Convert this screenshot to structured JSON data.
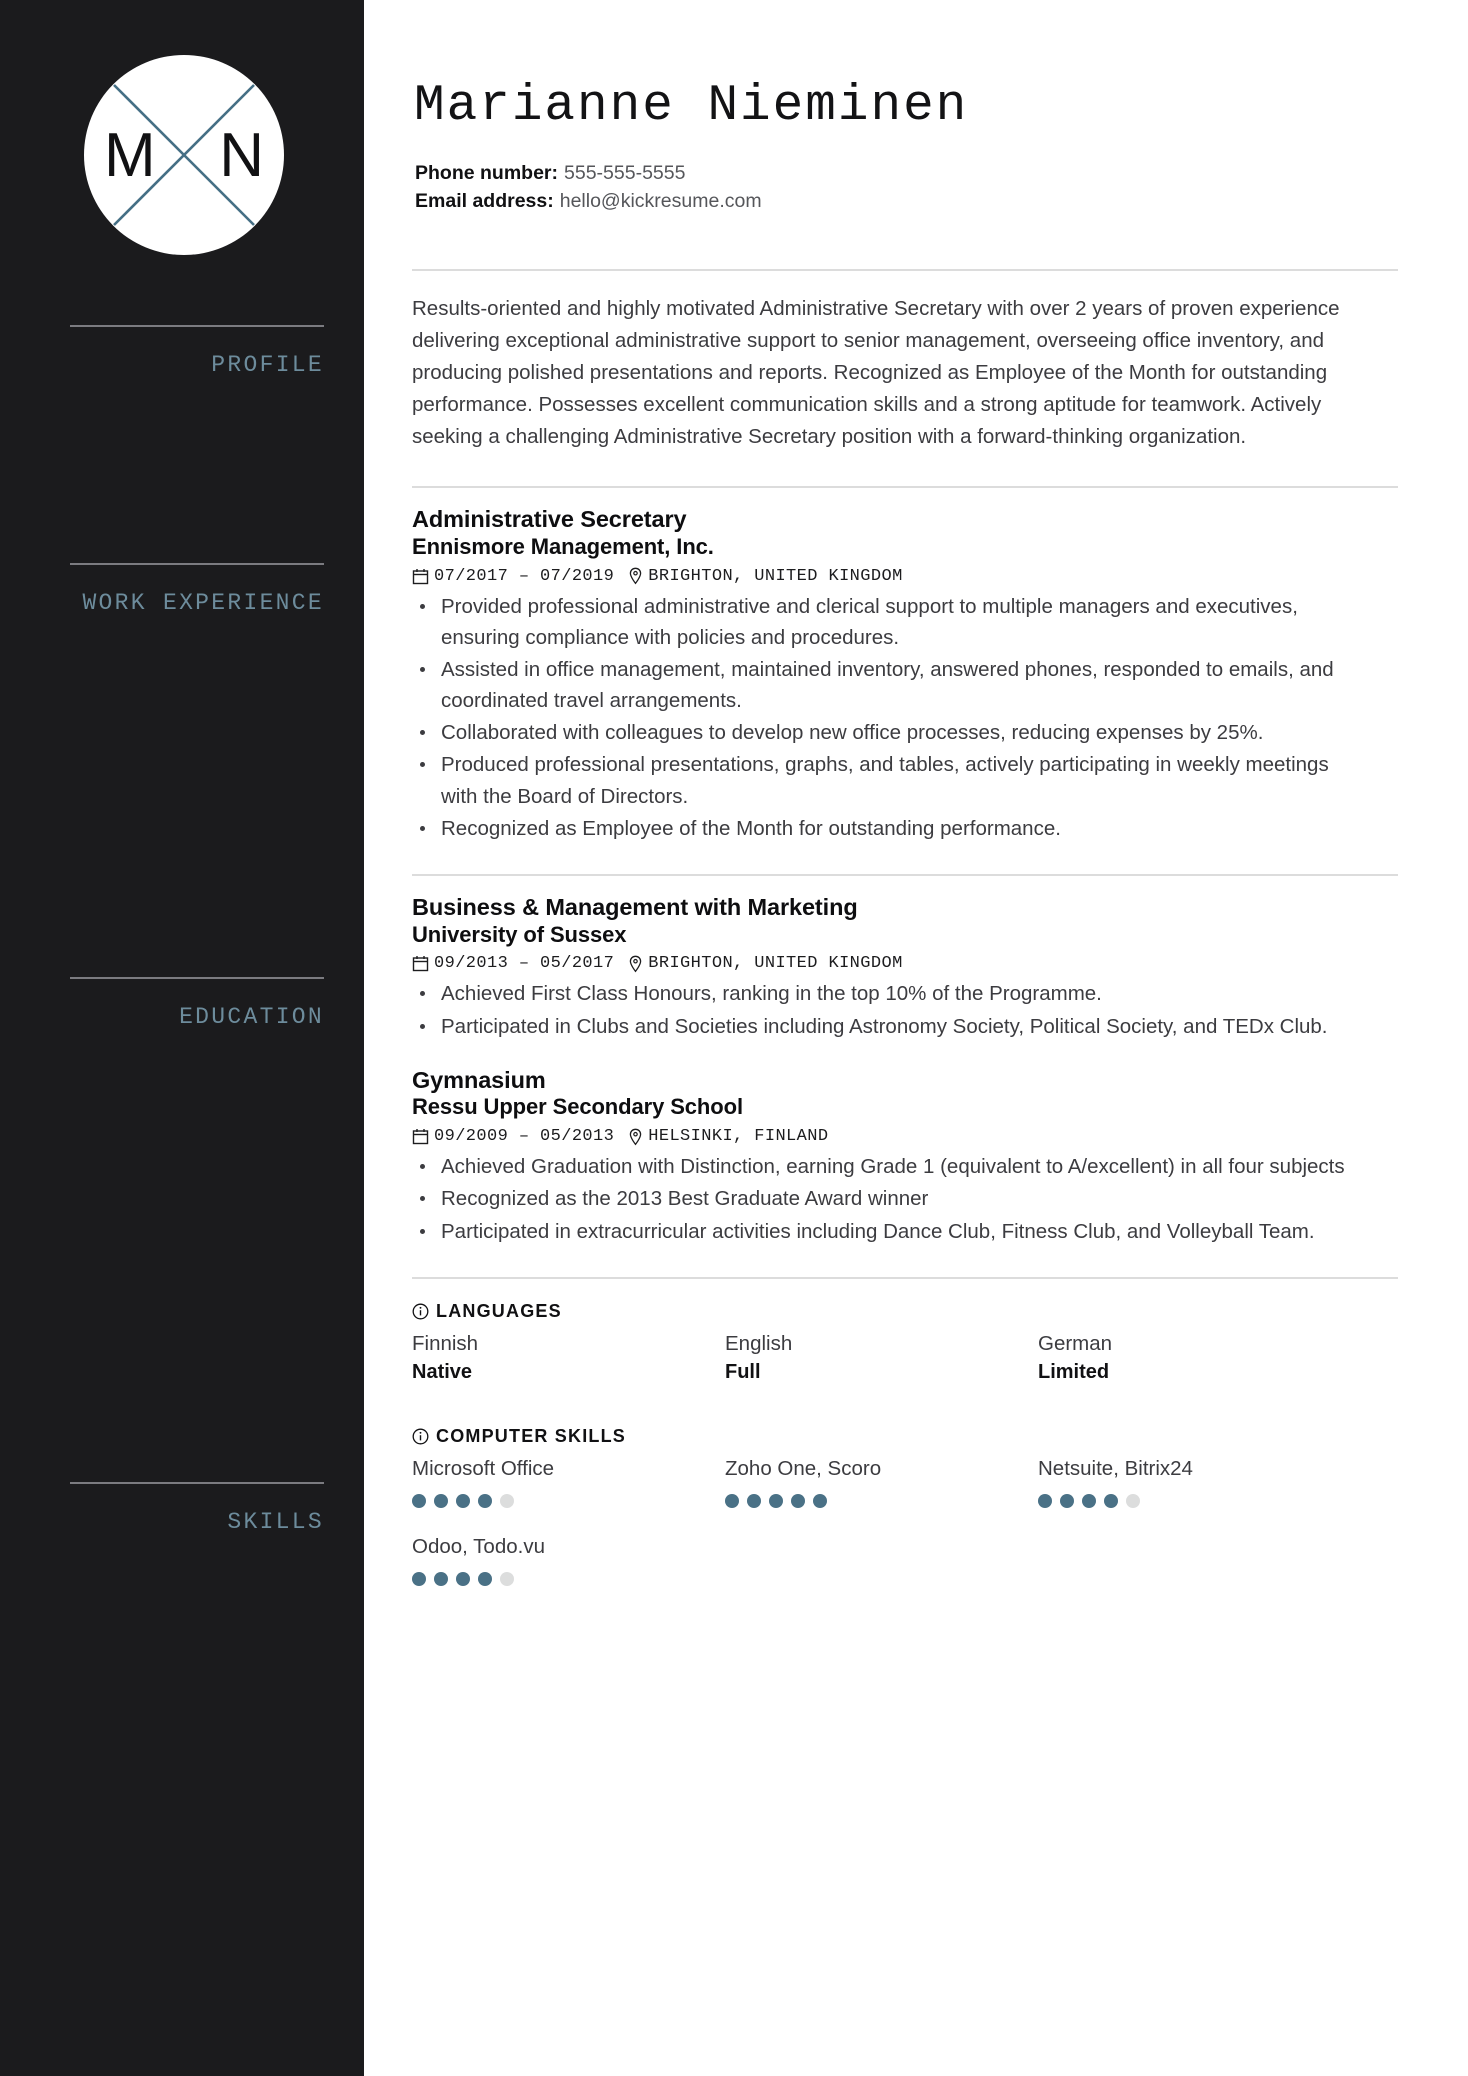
{
  "sidebar": {
    "monogram": {
      "left_letter": "M",
      "right_letter": "N",
      "icon": "monogram-cross-icon"
    },
    "sections": [
      {
        "key": "profile",
        "label": "PROFILE"
      },
      {
        "key": "work",
        "label": "WORK EXPERIENCE"
      },
      {
        "key": "education",
        "label": "EDUCATION"
      },
      {
        "key": "skills",
        "label": "SKILLS"
      }
    ]
  },
  "header": {
    "name": "Marianne Nieminen",
    "phone_label": "Phone number:",
    "phone_value": "555-555-5555",
    "email_label": "Email address:",
    "email_value": "hello@kickresume.com"
  },
  "profile": {
    "text": "Results-oriented and highly motivated Administrative Secretary with over 2 years of proven experience delivering exceptional administrative support to senior management, overseeing office inventory, and producing polished presentations and reports. Recognized as Employee of the Month for outstanding performance. Possesses excellent communication skills and a strong aptitude for teamwork. Actively seeking a challenging Administrative Secretary position with a forward-thinking organization."
  },
  "work": {
    "entries": [
      {
        "title": "Administrative Secretary",
        "organization": "Ennismore Management, Inc.",
        "dates": "07/2017 – 07/2019",
        "location": "BRIGHTON, UNITED KINGDOM",
        "bullets": [
          "Provided professional administrative and clerical support to multiple managers and executives, ensuring compliance with policies and procedures.",
          "Assisted in office management, maintained inventory, answered phones, responded to emails, and coordinated travel arrangements.",
          "Collaborated with colleagues to develop new office processes, reducing expenses by 25%.",
          "Produced professional presentations, graphs, and tables, actively participating in weekly meetings with the Board of Directors.",
          "Recognized as Employee of the Month for outstanding performance."
        ]
      }
    ]
  },
  "education": {
    "entries": [
      {
        "title": "Business & Management with Marketing",
        "organization": "University of Sussex",
        "dates": "09/2013 – 05/2017",
        "location": "BRIGHTON, UNITED KINGDOM",
        "bullets": [
          "Achieved First Class Honours, ranking in the top 10% of the Programme.",
          "Participated in Clubs and Societies including Astronomy Society, Political Society, and TEDx Club."
        ]
      },
      {
        "title": "Gymnasium",
        "organization": "Ressu Upper Secondary School",
        "dates": "09/2009 – 05/2013",
        "location": "HELSINKI, FINLAND",
        "bullets": [
          "Achieved Graduation with Distinction, earning Grade 1 (equivalent to A/excellent) in all four subjects",
          "Recognized as the 2013 Best Graduate Award winner",
          "Participated in extracurricular activities including Dance Club, Fitness Club, and Volleyball Team."
        ]
      }
    ]
  },
  "skills": {
    "languages": {
      "heading": "LANGUAGES",
      "items": [
        {
          "name": "Finnish",
          "level": "Native"
        },
        {
          "name": "English",
          "level": "Full"
        },
        {
          "name": "German",
          "level": "Limited"
        }
      ]
    },
    "computer": {
      "heading": "COMPUTER SKILLS",
      "max_dots": 5,
      "items": [
        {
          "name": "Microsoft Office",
          "rating": 4
        },
        {
          "name": "Zoho One, Scoro",
          "rating": 5
        },
        {
          "name": "Netsuite, Bitrix24",
          "rating": 4
        },
        {
          "name": "Odoo, Todo.vu",
          "rating": 4
        }
      ]
    }
  },
  "colors": {
    "sidebar_bg": "#1b1b1d",
    "sidebar_label": "#6d8c9c",
    "accent_dot": "#4a7186",
    "dot_off": "#dcdddd",
    "rule": "#dcdcdc"
  }
}
